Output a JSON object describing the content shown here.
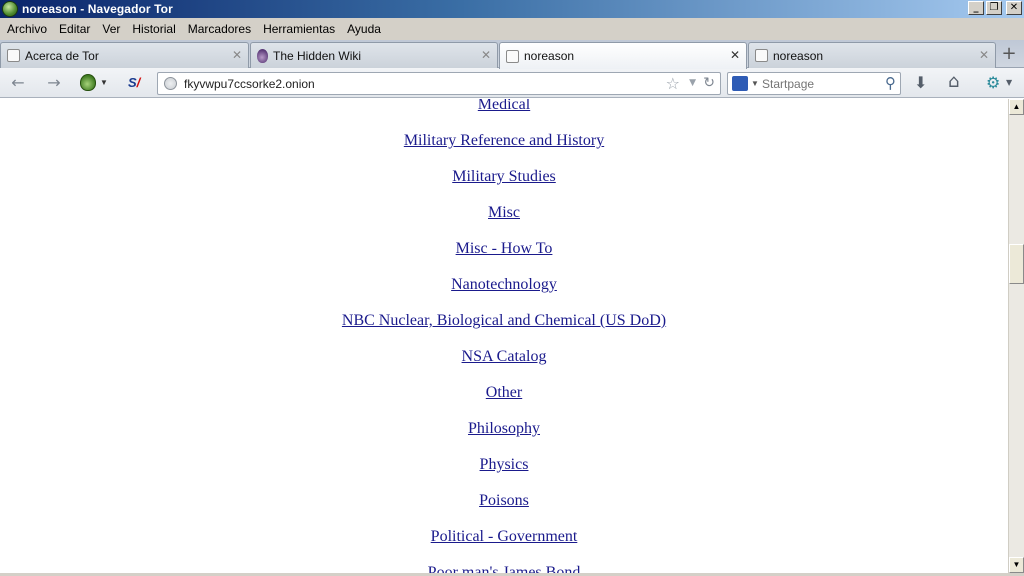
{
  "window": {
    "title": "noreason - Navegador Tor",
    "buttons": [
      "_",
      "❐",
      "✕"
    ]
  },
  "menu": [
    "Archivo",
    "Editar",
    "Ver",
    "Historial",
    "Marcadores",
    "Herramientas",
    "Ayuda"
  ],
  "tabs": [
    {
      "label": "Acerca de Tor",
      "icon": "blank-page-icon",
      "active": false
    },
    {
      "label": "The Hidden Wiki",
      "icon": "onion-icon",
      "active": false
    },
    {
      "label": "noreason",
      "icon": "blank-page-icon",
      "active": true
    },
    {
      "label": "noreason",
      "icon": "blank-page-icon",
      "active": false
    }
  ],
  "tab_close_glyph": "✕",
  "new_tab_glyph": "+",
  "toolbar": {
    "back_glyph": "←",
    "forward_glyph": "→",
    "noscript_label": "S",
    "url": "fkyvwpu7ccsorke2.onion",
    "bookmark_star_glyph": "☆",
    "url_dropdown_glyph": "▼",
    "reload_glyph": "↻",
    "search_placeholder": "Startpage",
    "search_glyph": "⚲",
    "download_glyph": "⬇",
    "home_glyph": "⌂",
    "addon_glyph": "⚙"
  },
  "links": [
    "Medical",
    "Military Reference and History",
    "Military Studies",
    "Misc",
    "Misc - How To",
    "Nanotechnology",
    "NBC Nuclear, Biological and Chemical (US DoD)",
    "NSA Catalog",
    "Other",
    "Philosophy",
    "Physics",
    "Poisons",
    "Political - Government",
    "Poor man's James Bond"
  ],
  "scroll": {
    "up_glyph": "▲",
    "down_glyph": "▼",
    "position": 0.32
  },
  "colors": {
    "link": "#1a1a8c",
    "titlebar_start": "#0a246a",
    "titlebar_end": "#a6caf0"
  }
}
